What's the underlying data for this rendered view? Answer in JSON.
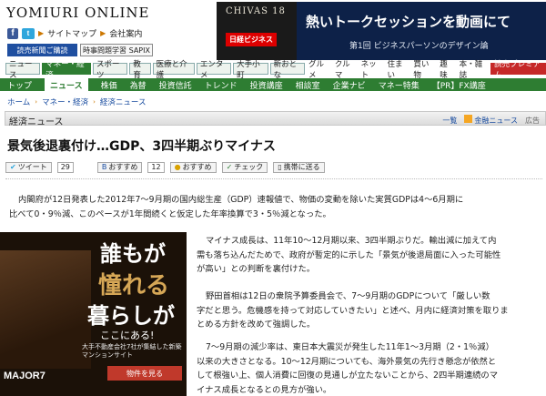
{
  "header": {
    "logo": "YOMIURI ONLINE",
    "sitemap": "サイトマップ",
    "company": "会社案内",
    "register_btn": "読売新聞ご購読",
    "sapix_btn": "時事問題学習 SAPIX",
    "fb_icon": "facebook-icon",
    "tw_icon": "twitter-icon"
  },
  "top_ad": {
    "brand": "CHIVAS 18",
    "sponsor": "日経ビジネス",
    "headline": "熱いトークセッションを動画にて",
    "sub": "第1回 ビジネスパーソンのデザイン論"
  },
  "category_nav": [
    {
      "label": "ニュース",
      "style": "box"
    },
    {
      "label": "マネー・経済",
      "style": "active"
    },
    {
      "label": "スポーツ",
      "style": "box"
    },
    {
      "label": "教育",
      "style": "box"
    },
    {
      "label": "医療と介護",
      "style": "box"
    },
    {
      "label": "エンタメ",
      "style": "box"
    },
    {
      "label": "大手小町",
      "style": "box"
    },
    {
      "label": "新おとな",
      "style": "box"
    },
    {
      "label": "グルメ",
      "style": "plain"
    },
    {
      "label": "クルマ",
      "style": "plain"
    },
    {
      "label": "ネット",
      "style": "plain"
    },
    {
      "label": "住まい",
      "style": "plain"
    },
    {
      "label": "買い物",
      "style": "plain"
    },
    {
      "label": "趣味",
      "style": "plain"
    },
    {
      "label": "本・雑誌",
      "style": "plain"
    },
    {
      "label": "読売プレミアム",
      "style": "prem"
    }
  ],
  "section_nav": [
    "トップ",
    "ニュース",
    "株価",
    "為替",
    "投資信託",
    "トレンド",
    "投資講座",
    "相談室",
    "企業ナビ",
    "マネー特集",
    "【PR】FX講座"
  ],
  "breadcrumb": [
    "ホーム",
    "マネー・経済",
    "経済ニュース"
  ],
  "section_bar": {
    "title": "経済ニュース",
    "list_link": "一覧",
    "rss": "金融ニュース",
    "ad": "広告"
  },
  "article": {
    "title": "景気後退裏付け…GDP、3四半期ぶりマイナス",
    "tweet_label": "ツイート",
    "tweet_count": "29",
    "hatena_label": "おすすめ",
    "hatena_count": "12",
    "mixi_label": "おすすめ",
    "check_label": "チェック",
    "mobile_label": "携帯に送る",
    "para1_l1": "内閣府が12日発表した2012年7～9月期の国内総生産（GDP）速報値で、物価の変動を除いた実質GDPは4～6月期に",
    "para1_l2": "比べて0・9％減、このペースが1年間続くと仮定した年率換算で3・5％減となった。",
    "para2_l1": "マイナス成長は、11年10～12月期以来、3四半期ぶりだ。輸出減に加えて内",
    "para2_l2": "需も落ち込んだためで、政府が暫定的に示した「景気が後退局面に入った可能性",
    "para2_l3": "が高い」との判断を裏付けた。",
    "para3_l1": "野田首相は12日の衆院予算委員会で、7～9月期のGDPについて「厳しい数",
    "para3_l2": "字だと思う。危機感を持って対応していきたい」と述べ、月内に経済対策を取りま",
    "para3_l3": "とめる方針を改めて強調した。",
    "para4_l1": "7～9月期の減少率は、東日本大震災が発生した11年1～3月期（2・1％減）",
    "para4_l2": "以来の大きさとなる。10～12月期についても、海外景気の先行き懸念が依然と",
    "para4_l3": "して根強い上、個人消費に回復の見通しが立たないことから、2四半期連続のマ",
    "para4_l4": "イナス成長となるとの見方が強い。"
  },
  "side_ad": {
    "k1": "誰もが",
    "k2": "憧れる",
    "k3": "暮らしが",
    "k4": "ここにある!",
    "small": "大手不動産会社7社が集結した新築マンションサイト",
    "logo": "MAJOR7",
    "button": "物件を見る"
  }
}
